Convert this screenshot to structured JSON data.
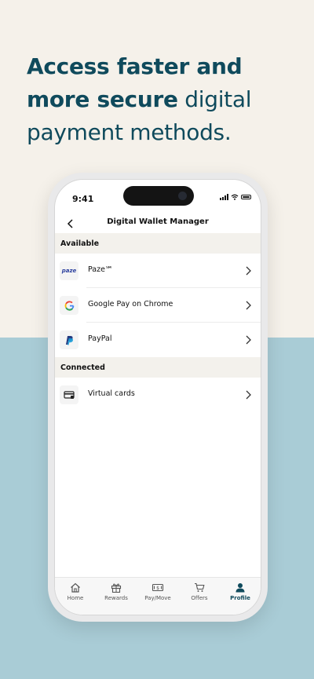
{
  "headline": {
    "bold_part": "Access faster and more secure",
    "light_part": "digital payment methods."
  },
  "status_bar": {
    "time": "9:41"
  },
  "screen": {
    "title": "Digital Wallet Manager",
    "back_icon": "chevron-left-icon",
    "sections": [
      {
        "title": "Available",
        "items": [
          {
            "label": "Paze℠",
            "icon": "paze-logo-icon",
            "logo_text": "paze"
          },
          {
            "label": "Google Pay on Chrome",
            "icon": "google-g-logo-icon"
          },
          {
            "label": "PayPal",
            "icon": "paypal-logo-icon"
          }
        ]
      },
      {
        "title": "Connected",
        "items": [
          {
            "label": "Virtual cards",
            "icon": "virtual-card-icon"
          }
        ]
      }
    ]
  },
  "tabbar": {
    "items": [
      {
        "label": "Home",
        "icon": "home-icon"
      },
      {
        "label": "Rewards",
        "icon": "gift-icon"
      },
      {
        "label": "Pay/Move",
        "icon": "pay-move-icon"
      },
      {
        "label": "Offers",
        "icon": "cart-icon"
      },
      {
        "label": "Profile",
        "icon": "profile-icon",
        "active": true
      }
    ]
  },
  "colors": {
    "top_background": "#f5f1ea",
    "bottom_background": "#a9ccd6",
    "brand_teal": "#0f4a5c",
    "section_header_bg": "#f3f1ec"
  }
}
